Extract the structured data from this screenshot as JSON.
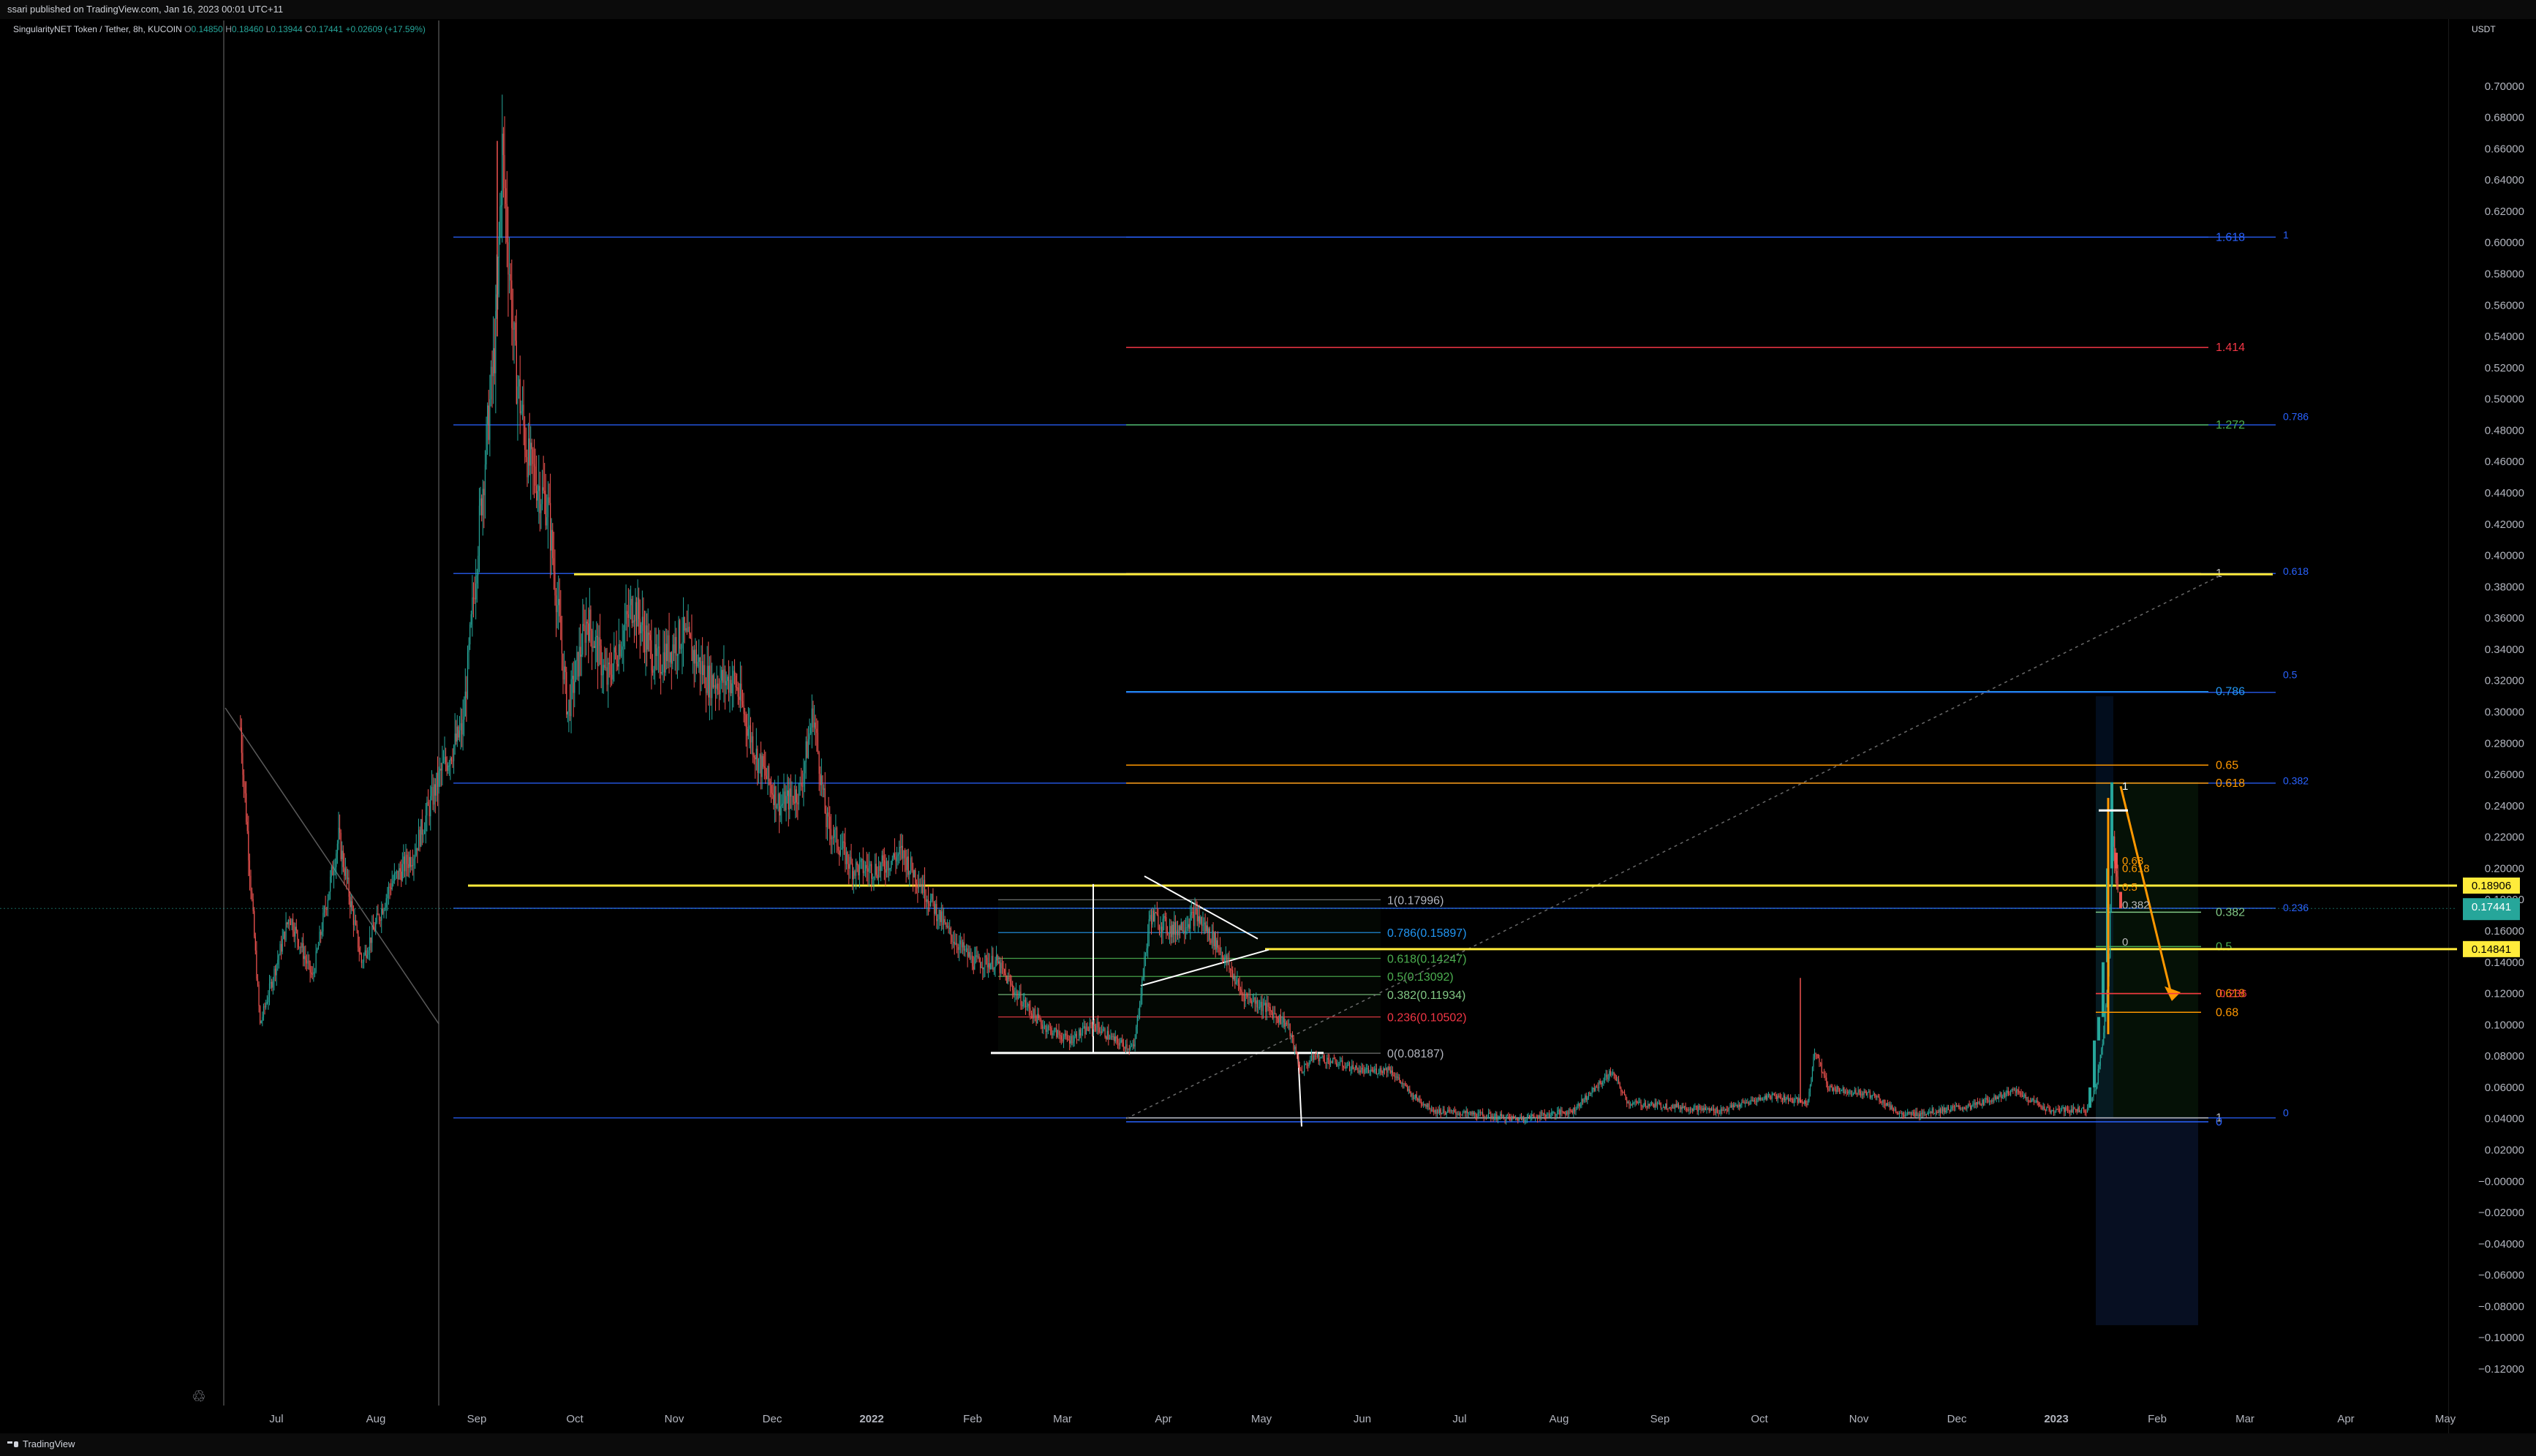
{
  "header": {
    "publish_line": "ssari published on TradingView.com, Jan 16, 2023 00:01 UTC+11"
  },
  "legend": {
    "symbol": "SingularityNET Token / Tether, 8h, KUCOIN",
    "o_label": "O",
    "o_value": "0.14850",
    "h_label": "H",
    "h_value": "0.18460",
    "l_label": "L",
    "l_value": "0.13944",
    "c_label": "C",
    "c_value": "0.17441",
    "change": "+0.02609 (+17.59%)"
  },
  "currency_label": "USDT",
  "footer": {
    "brand": "TradingView"
  },
  "colors": {
    "background": "#000000",
    "up": "#26a69a",
    "down": "#ef5350",
    "fib_blue": "#2962ff",
    "yellow": "#ffeb3b",
    "orange": "#ff9800",
    "price_tag": "#26a69a"
  },
  "chart_data": {
    "type": "candlestick",
    "symbol": "AGIX/USDT",
    "interval": "8h",
    "exchange": "KUCOIN",
    "x_ticks": [
      "Jul",
      "Aug",
      "Sep",
      "Oct",
      "Nov",
      "Dec",
      "2022",
      "Feb",
      "Mar",
      "Apr",
      "May",
      "Jun",
      "Jul",
      "Aug",
      "Sep",
      "Oct",
      "Nov",
      "Dec",
      "2023",
      "Feb",
      "Mar",
      "Apr",
      "May"
    ],
    "y_ticks": [
      "0.70000",
      "0.68000",
      "0.66000",
      "0.64000",
      "0.62000",
      "0.60000",
      "0.58000",
      "0.56000",
      "0.54000",
      "0.52000",
      "0.50000",
      "0.48000",
      "0.46000",
      "0.44000",
      "0.42000",
      "0.40000",
      "0.38000",
      "0.36000",
      "0.34000",
      "0.32000",
      "0.30000",
      "0.28000",
      "0.26000",
      "0.24000",
      "0.22000",
      "0.20000",
      "0.18000",
      "0.16000",
      "0.14000",
      "0.12000",
      "0.10000",
      "0.08000",
      "0.06000",
      "0.04000",
      "0.02000",
      "−0.00000",
      "−0.02000",
      "−0.04000",
      "−0.06000",
      "−0.08000",
      "−0.10000",
      "−0.12000"
    ],
    "ylim": [
      -0.127,
      0.713
    ],
    "price_path": [
      [
        "2021-06-20",
        0.29
      ],
      [
        "2021-06-26",
        0.1
      ],
      [
        "2021-07-05",
        0.17
      ],
      [
        "2021-07-12",
        0.13
      ],
      [
        "2021-07-20",
        0.22
      ],
      [
        "2021-07-27",
        0.14
      ],
      [
        "2021-08-05",
        0.19
      ],
      [
        "2021-08-12",
        0.21
      ],
      [
        "2021-08-20",
        0.26
      ],
      [
        "2021-08-27",
        0.29
      ],
      [
        "2021-09-01",
        0.42
      ],
      [
        "2021-09-06",
        0.54
      ],
      [
        "2021-09-08",
        0.66
      ],
      [
        "2021-09-12",
        0.52
      ],
      [
        "2021-09-16",
        0.46
      ],
      [
        "2021-09-22",
        0.43
      ],
      [
        "2021-09-28",
        0.3
      ],
      [
        "2021-10-04",
        0.36
      ],
      [
        "2021-10-10",
        0.32
      ],
      [
        "2021-10-18",
        0.37
      ],
      [
        "2021-10-25",
        0.33
      ],
      [
        "2021-11-02",
        0.35
      ],
      [
        "2021-11-10",
        0.32
      ],
      [
        "2021-11-18",
        0.32
      ],
      [
        "2021-11-25",
        0.27
      ],
      [
        "2021-12-02",
        0.24
      ],
      [
        "2021-12-08",
        0.25
      ],
      [
        "2021-12-12",
        0.3
      ],
      [
        "2021-12-16",
        0.23
      ],
      [
        "2021-12-24",
        0.2
      ],
      [
        "2022-01-01",
        0.2
      ],
      [
        "2022-01-08",
        0.21
      ],
      [
        "2022-01-14",
        0.19
      ],
      [
        "2022-01-22",
        0.16
      ],
      [
        "2022-01-30",
        0.14
      ],
      [
        "2022-02-06",
        0.14
      ],
      [
        "2022-02-12",
        0.12
      ],
      [
        "2022-02-20",
        0.1
      ],
      [
        "2022-02-28",
        0.09
      ],
      [
        "2022-03-08",
        0.1
      ],
      [
        "2022-03-14",
        0.09
      ],
      [
        "2022-03-20",
        0.085
      ],
      [
        "2022-03-25",
        0.17
      ],
      [
        "2022-04-01",
        0.16
      ],
      [
        "2022-04-08",
        0.17
      ],
      [
        "2022-04-15",
        0.15
      ],
      [
        "2022-04-22",
        0.12
      ],
      [
        "2022-04-30",
        0.11
      ],
      [
        "2022-05-06",
        0.1
      ],
      [
        "2022-05-10",
        0.07
      ],
      [
        "2022-05-14",
        0.08
      ],
      [
        "2022-05-22",
        0.075
      ],
      [
        "2022-05-30",
        0.07
      ],
      [
        "2022-06-06",
        0.072
      ],
      [
        "2022-06-13",
        0.055
      ],
      [
        "2022-06-20",
        0.045
      ],
      [
        "2022-07-01",
        0.043
      ],
      [
        "2022-07-15",
        0.04
      ],
      [
        "2022-08-01",
        0.045
      ],
      [
        "2022-08-13",
        0.07
      ],
      [
        "2022-08-18",
        0.05
      ],
      [
        "2022-09-01",
        0.048
      ],
      [
        "2022-09-15",
        0.045
      ],
      [
        "2022-10-01",
        0.055
      ],
      [
        "2022-10-12",
        0.05
      ],
      [
        "2022-10-14",
        0.085
      ],
      [
        "2022-10-18",
        0.06
      ],
      [
        "2022-11-01",
        0.055
      ],
      [
        "2022-11-10",
        0.042
      ],
      [
        "2022-11-20",
        0.045
      ],
      [
        "2022-12-01",
        0.048
      ],
      [
        "2022-12-14",
        0.058
      ],
      [
        "2022-12-25",
        0.045
      ],
      [
        "2023-01-05",
        0.046
      ],
      [
        "2023-01-08",
        0.06
      ],
      [
        "2023-01-10",
        0.09
      ],
      [
        "2023-01-12",
        0.14
      ],
      [
        "2023-01-13",
        0.22
      ],
      [
        "2023-01-14",
        0.2
      ],
      [
        "2023-01-15",
        0.17441
      ]
    ],
    "last_close": 0.17441,
    "horizontal_levels": [
      {
        "price": 0.189,
        "color": "#ffeb3b",
        "tag": "0.18906"
      },
      {
        "price": 0.1484,
        "color": "#ffeb3b",
        "tag": "0.14841"
      },
      {
        "price": 0.388,
        "color": "#ffeb3b"
      }
    ],
    "fib_extension_left": [
      {
        "ratio": "1.618",
        "price": 0.6035
      },
      {
        "ratio": "1.414",
        "price": 0.533
      },
      {
        "ratio": "1.272",
        "price": 0.4835
      },
      {
        "ratio": "1",
        "price": 0.3885
      },
      {
        "ratio": "0.786",
        "price": 0.313
      },
      {
        "ratio": "0.65",
        "price": 0.266
      },
      {
        "ratio": "0.618",
        "price": 0.2545
      },
      {
        "ratio": "0.382",
        "price": 0.172
      },
      {
        "ratio": "0.5",
        "price": 0.15
      },
      {
        "ratio": "0.618",
        "price": 0.12
      },
      {
        "ratio": "0.68",
        "price": 0.108
      },
      {
        "ratio": "1",
        "price": 0.0405
      },
      {
        "ratio": "0",
        "price": 0.038
      }
    ],
    "fib_right_labels": [
      {
        "ratio": "1",
        "price": 0.6045
      },
      {
        "ratio": "0.786",
        "price": 0.4885
      },
      {
        "ratio": "0.618",
        "price": 0.3895
      },
      {
        "ratio": "0.5",
        "price": 0.3235
      },
      {
        "ratio": "0.382",
        "price": 0.2555
      },
      {
        "ratio": "0.236",
        "price": 0.1745
      },
      {
        "ratio": "0",
        "price": 0.0435
      }
    ],
    "fib_retracement_mid": [
      {
        "label": "1(0.17996)",
        "price": 0.17996
      },
      {
        "label": "0.786(0.15897)",
        "price": 0.15897
      },
      {
        "label": "0.618(0.14247)",
        "price": 0.14247
      },
      {
        "label": "0.5(0.13092)",
        "price": 0.13092
      },
      {
        "label": "0.382(0.11934)",
        "price": 0.11934
      },
      {
        "label": "0.236(0.10502)",
        "price": 0.10502
      },
      {
        "label": "0(0.08187)",
        "price": 0.08187
      }
    ],
    "fib_small_right": [
      {
        "label": "1",
        "price": 0.2525
      },
      {
        "label": "0.68",
        "price": 0.205
      },
      {
        "label": "0.618",
        "price": 0.2
      },
      {
        "label": "0.5",
        "price": 0.188
      },
      {
        "label": "0.382",
        "price": 0.1765
      },
      {
        "label": "0",
        "price": 0.153
      },
      {
        "label": "0.236",
        "price": 0.12
      }
    ]
  }
}
